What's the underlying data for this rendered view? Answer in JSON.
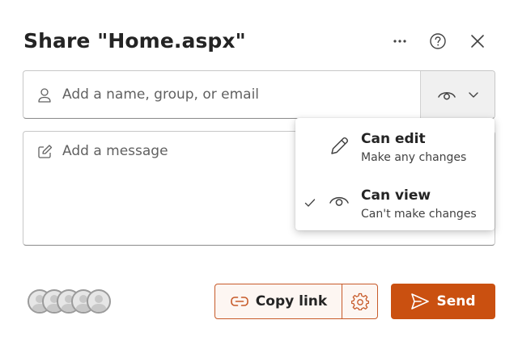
{
  "dialog": {
    "title": "Share \"Home.aspx\"",
    "more_options_icon": "more-horizontal-icon",
    "help_icon": "question-circle-icon",
    "close_icon": "close-icon"
  },
  "invite": {
    "placeholder": "Add a name, group, or email",
    "value": "",
    "leading_icon": "person-icon",
    "permission_button": {
      "icon": "eye-icon",
      "chevron": "chevron-down-icon",
      "selected": "Can view"
    }
  },
  "message": {
    "placeholder": "Add a message",
    "value": "",
    "leading_icon": "compose-icon"
  },
  "permission_menu": {
    "items": [
      {
        "label": "Can edit",
        "description": "Make any changes",
        "icon": "pencil-icon",
        "selected": false
      },
      {
        "label": "Can view",
        "description": "Can't make changes",
        "icon": "eye-icon",
        "selected": true
      }
    ]
  },
  "footer": {
    "avatars_count": 5,
    "copy_link_label": "Copy link",
    "copy_link_icon": "link-icon",
    "settings_icon": "gear-icon",
    "send_label": "Send",
    "send_icon": "send-icon"
  },
  "colors": {
    "accent": "#ca5010",
    "accent_border": "#c75a29",
    "text": "#242424",
    "placeholder": "#616161"
  }
}
